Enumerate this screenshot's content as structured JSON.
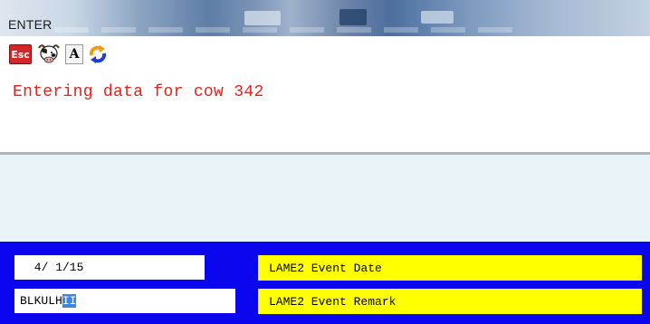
{
  "window": {
    "title": "ENTER"
  },
  "toolbar": {
    "buttons": [
      {
        "label": "Esc",
        "icon": "esc-icon"
      },
      {
        "icon": "cow-icon"
      },
      {
        "label": "A",
        "icon": "font-a-icon"
      },
      {
        "icon": "refresh-icon"
      }
    ]
  },
  "message": {
    "text": "Entering data for cow 342",
    "color": "#e0241d"
  },
  "entry": {
    "panel_color": "#0a07ee",
    "label_color": "#ffff00",
    "fields": [
      {
        "value": " 4/ 1/15",
        "label": "LAME2 Event Date"
      },
      {
        "value": "BLKULH",
        "selected_text": "II",
        "label": "LAME2 Event Remark"
      }
    ]
  }
}
